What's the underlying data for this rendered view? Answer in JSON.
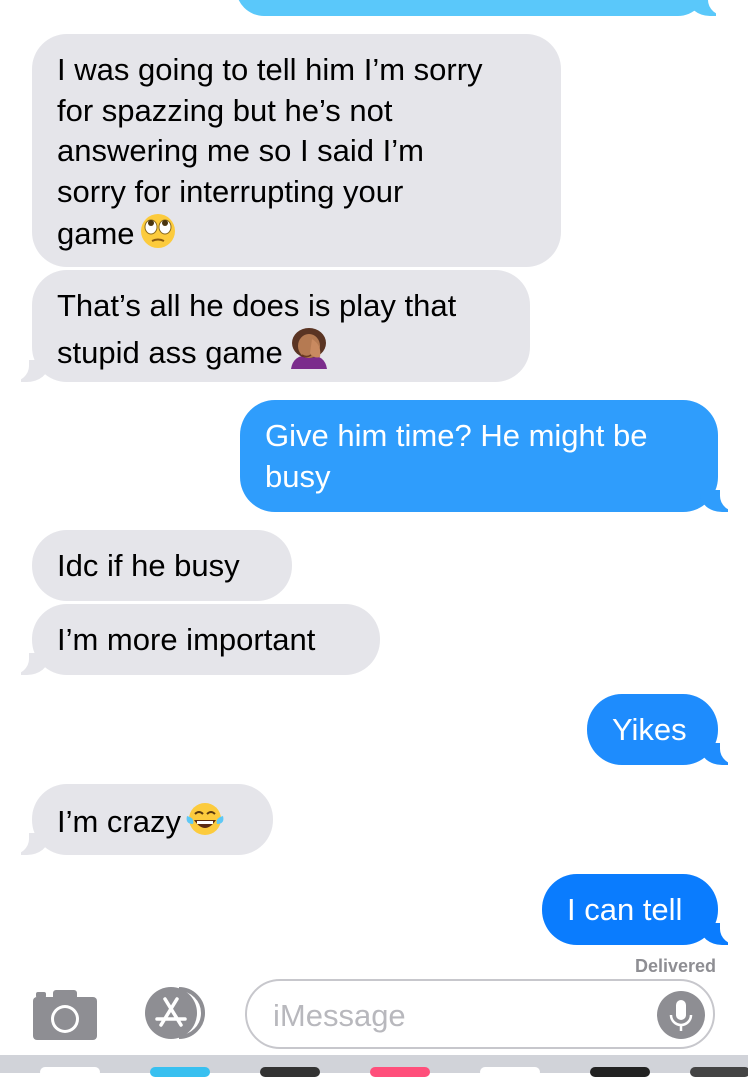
{
  "messages": [
    {
      "side": "received",
      "text": "I was going to tell him I’m sorry\nfor spazzing but he’s not\nanswering me so I said I’m\nsorry for interrupting your\ngame",
      "emoji": "eye-roll"
    },
    {
      "side": "received",
      "text": "That’s all he does is play that\nstupid ass game",
      "emoji": "facepalm"
    },
    {
      "side": "sent",
      "text": "Give him time? He might be\nbusy"
    },
    {
      "side": "received",
      "text": "Idc if he busy"
    },
    {
      "side": "received",
      "text": "I’m more important"
    },
    {
      "side": "sent",
      "text": "Yikes"
    },
    {
      "side": "received",
      "text": "I’m crazy",
      "emoji": "tears-of-joy"
    },
    {
      "side": "sent",
      "text": "I can tell"
    }
  ],
  "status": {
    "delivered": "Delivered"
  },
  "composer": {
    "placeholder": "iMessage",
    "camera_icon": "camera-icon",
    "apps_icon": "app-store-icon",
    "mic_icon": "microphone-icon"
  },
  "colors": {
    "received_bubble": "#e5e5ea",
    "sent_bubble_top": "#5ac8fa",
    "sent_bubble_bottom": "#0a84ff",
    "delivered_text": "#8e8e93"
  }
}
